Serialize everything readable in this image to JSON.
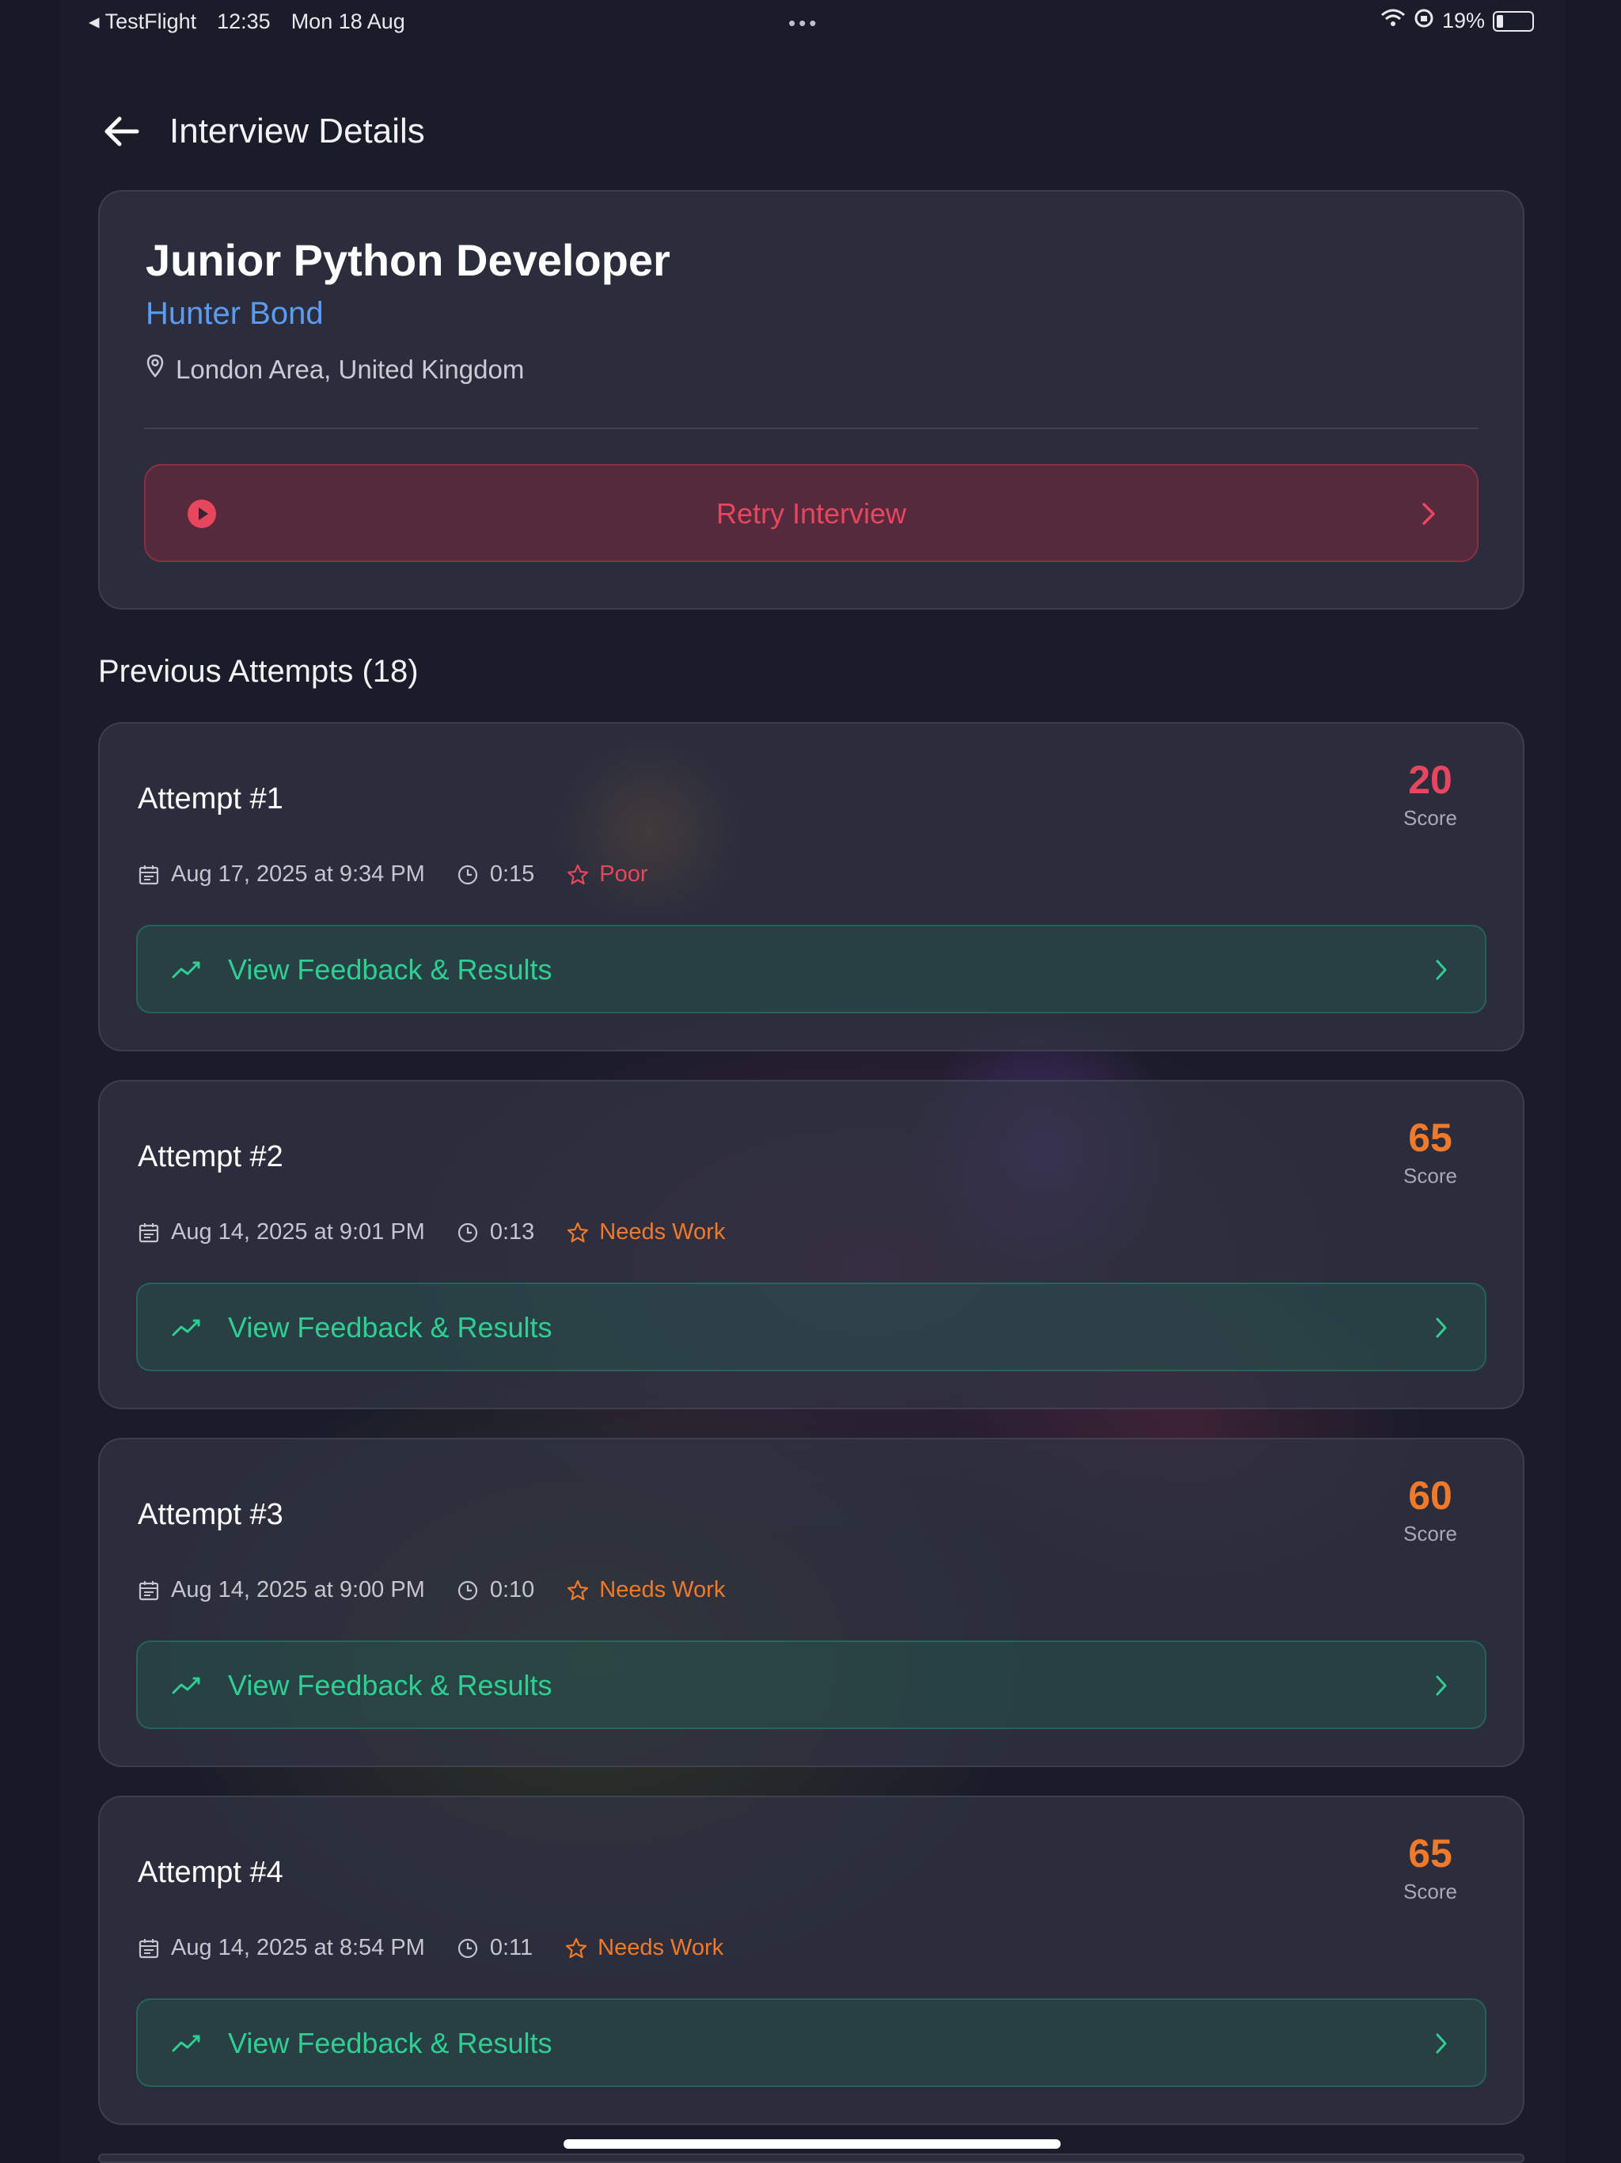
{
  "status_bar": {
    "back_app": "◂ TestFlight",
    "time": "12:35",
    "date": "Mon 18 Aug",
    "dots": "•••",
    "battery": "19%"
  },
  "header": {
    "title": "Interview Details"
  },
  "job": {
    "title": "Junior Python Developer",
    "company": "Hunter Bond",
    "location": "London Area, United Kingdom",
    "retry_label": "Retry Interview"
  },
  "attempts_section": {
    "title": "Previous Attempts (18)"
  },
  "attempts": [
    {
      "title": "Attempt #1",
      "score": "20",
      "score_label": "Score",
      "date": "Aug 17, 2025 at 9:34 PM",
      "duration": "0:15",
      "rating": "Poor",
      "action": "View Feedback & Results"
    },
    {
      "title": "Attempt #2",
      "score": "65",
      "score_label": "Score",
      "date": "Aug 14, 2025 at 9:01 PM",
      "duration": "0:13",
      "rating": "Needs Work",
      "action": "View Feedback & Results"
    },
    {
      "title": "Attempt #3",
      "score": "60",
      "score_label": "Score",
      "date": "Aug 14, 2025 at 9:00 PM",
      "duration": "0:10",
      "rating": "Needs Work",
      "action": "View Feedback & Results"
    },
    {
      "title": "Attempt #4",
      "score": "65",
      "score_label": "Score",
      "date": "Aug 14, 2025 at 8:54 PM",
      "duration": "0:11",
      "rating": "Needs Work",
      "action": "View Feedback & Results"
    }
  ],
  "colors": {
    "poor": "#e8455f",
    "needs_work": "#f07a2a",
    "accent_green": "#2fce93",
    "accent_blue": "#5b9cf0"
  }
}
